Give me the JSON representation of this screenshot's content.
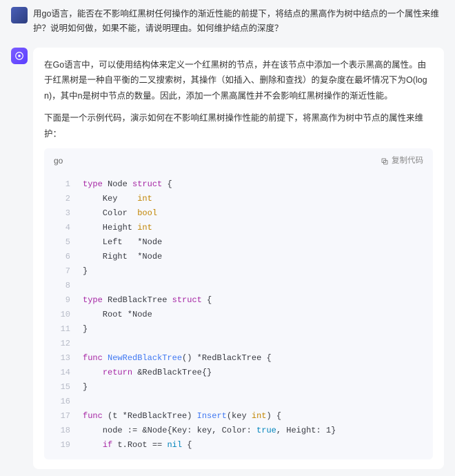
{
  "user": {
    "text": "用go语言，能否在不影响红黑树任何操作的渐近性能的前提下，将结点的黑高作为树中结点的一个属性来维护？说明如何做，如果不能，请说明理由。如何维护结点的深度？"
  },
  "answer": {
    "p1": "在Go语言中，可以使用结构体来定义一个红黑树的节点，并在该节点中添加一个表示黑高的属性。由于红黑树是一种自平衡的二叉搜索树，其操作（如插入、删除和查找）的复杂度在最坏情况下为O(log n)，其中n是树中节点的数量。因此，添加一个黑高属性并不会影响红黑树操作的渐近性能。",
    "p2": "下面是一个示例代码，演示如何在不影响红黑树操作性能的前提下，将黑高作为树中节点的属性来维护："
  },
  "code": {
    "lang": "go",
    "copy": "复制代码"
  }
}
